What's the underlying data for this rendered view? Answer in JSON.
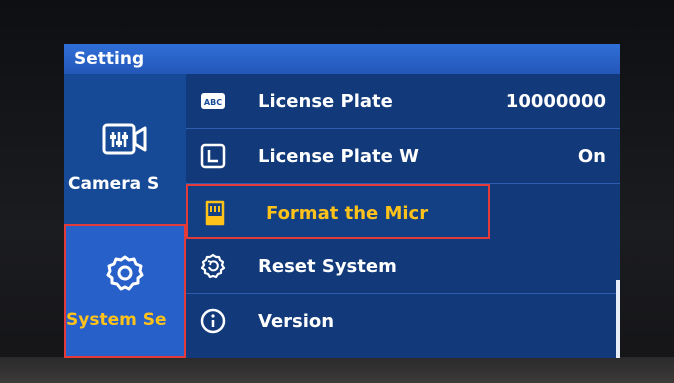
{
  "title": "Setting",
  "sidebar": {
    "items": [
      {
        "label": "Camera S",
        "icon": "camera-settings-icon",
        "selected": false
      },
      {
        "label": "System Se",
        "icon": "gear-icon",
        "selected": true
      }
    ]
  },
  "menu": {
    "items": [
      {
        "label": "License Plate",
        "value": "10000000",
        "icon": "abc-icon"
      },
      {
        "label": "License Plate W",
        "value": "On",
        "icon": "corner-l-icon"
      },
      {
        "label": "Format the Micr",
        "value": "",
        "icon": "sd-card-icon",
        "selected": true
      },
      {
        "label": "Reset System",
        "value": "",
        "icon": "reset-gear-icon"
      },
      {
        "label": "Version",
        "value": "",
        "icon": "info-icon"
      }
    ]
  },
  "colors": {
    "titlebar": "#2457b8",
    "panel": "#164a96",
    "highlight": "#ffc21a",
    "selection_border": "#e33a3a"
  }
}
